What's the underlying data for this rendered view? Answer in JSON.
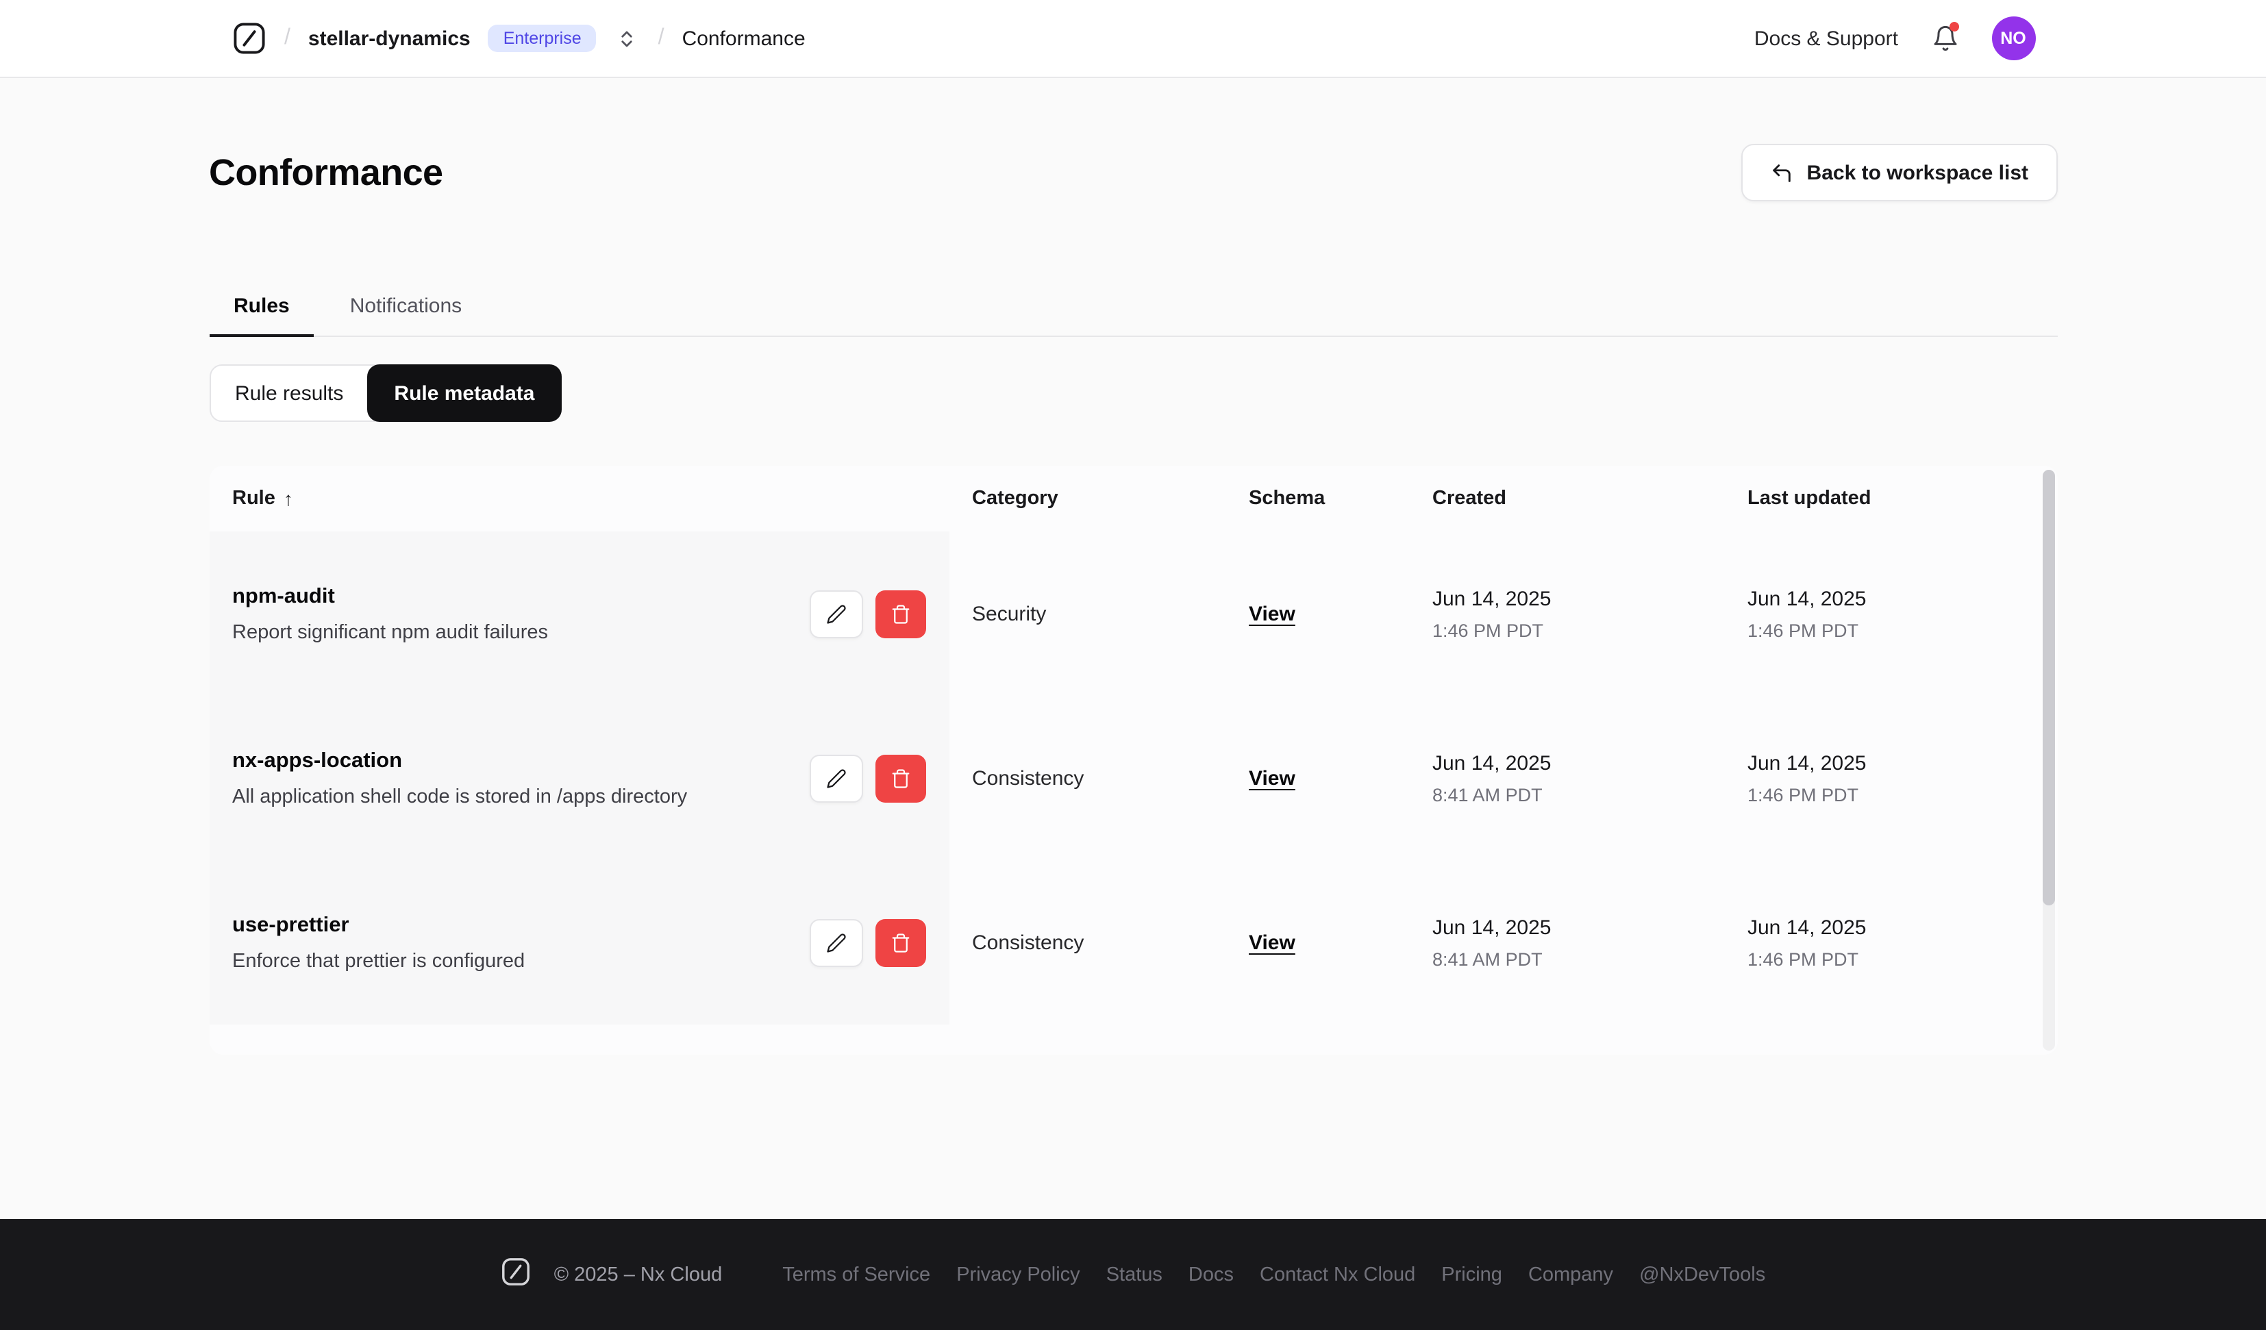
{
  "nav": {
    "breadcrumb": {
      "workspace": "stellar-dynamics",
      "badge": "Enterprise",
      "separator": "/",
      "page": "Conformance"
    },
    "docs_support": "Docs & Support",
    "avatar_initials": "NO"
  },
  "header": {
    "title": "Conformance",
    "back_button": "Back to workspace list"
  },
  "tabs": [
    {
      "label": "Rules",
      "active": true
    },
    {
      "label": "Notifications",
      "active": false
    }
  ],
  "segmented": [
    {
      "label": "Rule results",
      "active": false
    },
    {
      "label": "Rule metadata",
      "active": true
    }
  ],
  "table": {
    "columns": [
      "Rule",
      "Category",
      "Schema",
      "Created",
      "Last updated"
    ],
    "sort_indicator": "↑",
    "schema_link_label": "View",
    "rows": [
      {
        "name": "npm-audit",
        "description": "Report significant npm audit failures",
        "category": "Security",
        "created_date": "Jun 14, 2025",
        "created_time": "1:46 PM PDT",
        "updated_date": "Jun 14, 2025",
        "updated_time": "1:46 PM PDT"
      },
      {
        "name": "nx-apps-location",
        "description": "All application shell code is stored in /apps directory",
        "category": "Consistency",
        "created_date": "Jun 14, 2025",
        "created_time": "8:41 AM PDT",
        "updated_date": "Jun 14, 2025",
        "updated_time": "1:46 PM PDT"
      },
      {
        "name": "use-prettier",
        "description": "Enforce that prettier is configured",
        "category": "Consistency",
        "created_date": "Jun 14, 2025",
        "created_time": "8:41 AM PDT",
        "updated_date": "Jun 14, 2025",
        "updated_time": "1:46 PM PDT"
      }
    ]
  },
  "footer": {
    "copyright": "© 2025 – Nx Cloud",
    "links": [
      "Terms of Service",
      "Privacy Policy",
      "Status",
      "Docs",
      "Contact Nx Cloud",
      "Pricing",
      "Company",
      "@NxDevTools"
    ]
  },
  "icons": {
    "brand": "nx-logo",
    "workspace_switcher": "chevrons-up-down-icon",
    "notifications": "bell-icon",
    "back": "return-arrow-icon",
    "edit": "pencil-icon",
    "delete": "trash-icon",
    "sort": "arrow-up-icon"
  },
  "colors": {
    "enterprise_badge_bg": "#e0e7ff",
    "enterprise_badge_text": "#4f46e5",
    "delete_button": "#ef4444",
    "notification_dot": "#ef4444",
    "avatar_bg": "#9333ea",
    "active_segment_bg": "#111113",
    "footer_bg": "#18181b"
  }
}
